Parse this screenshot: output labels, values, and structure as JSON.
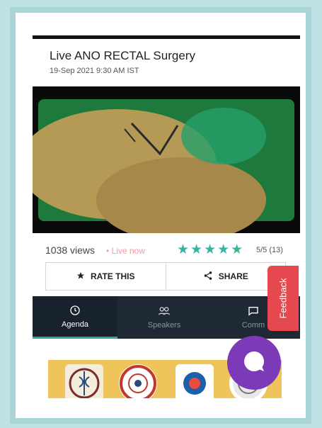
{
  "event": {
    "title": "Live ANO RECTAL Surgery",
    "datetime": "19-Sep 2021 9:30 AM IST"
  },
  "stats": {
    "views": "1038 views",
    "live": "• Live now",
    "stars": "★★★★★",
    "rating_value": 5,
    "rating_text": "5/5 (13)"
  },
  "actions": {
    "rate_label": "RATE THIS",
    "share_label": "SHARE"
  },
  "tabs": [
    {
      "label": "Agenda",
      "icon": "clock-icon",
      "active": true
    },
    {
      "label": "Speakers",
      "icon": "people-icon",
      "active": false
    },
    {
      "label": "Comm",
      "icon": "comment-icon",
      "active": false
    }
  ],
  "feedback": {
    "label": "Feedback"
  },
  "colors": {
    "accent": "#2aa7a0",
    "stars": "#35b5a2",
    "live": "#f19aa3",
    "feedback": "#e5484e",
    "chat": "#7d3ab8",
    "tabbar": "#1e2934",
    "sponsor_bg": "#efc45a"
  }
}
